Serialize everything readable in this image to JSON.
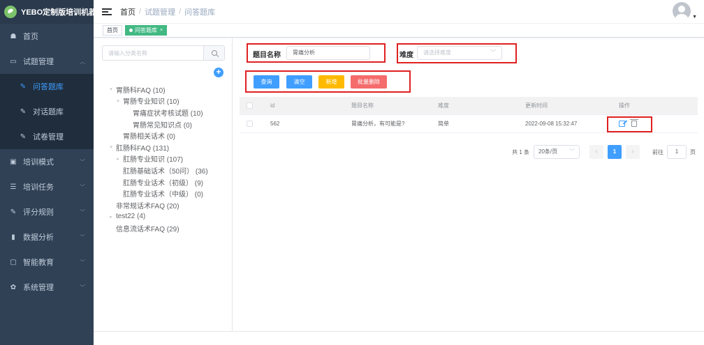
{
  "app": {
    "title": "YEBO定制版培训机器人"
  },
  "sidebar": {
    "items": [
      {
        "label": "首页",
        "icon": "dashboard-icon"
      },
      {
        "label": "试题管理",
        "icon": "book-icon",
        "expanded": true,
        "children": [
          {
            "label": "问答题库",
            "icon": "edit-icon",
            "active": true
          },
          {
            "label": "对话题库",
            "icon": "edit-icon"
          },
          {
            "label": "试卷管理",
            "icon": "edit-icon"
          }
        ]
      },
      {
        "label": "培训模式",
        "icon": "monitor-icon"
      },
      {
        "label": "培训任务",
        "icon": "list-icon"
      },
      {
        "label": "评分规则",
        "icon": "edit-icon"
      },
      {
        "label": "数据分析",
        "icon": "bar-chart-icon"
      },
      {
        "label": "智能教育",
        "icon": "screen-icon"
      },
      {
        "label": "系统管理",
        "icon": "gear-icon"
      }
    ]
  },
  "header": {
    "breadcrumb": [
      "首页",
      "试题管理",
      "问答题库"
    ],
    "separator": "/"
  },
  "tags": [
    {
      "label": "首页",
      "active": false
    },
    {
      "label": "问答题库",
      "active": true,
      "close": "×"
    }
  ],
  "tree": {
    "search_placeholder": "请输入分类名称",
    "nodes": [
      {
        "label": "胃肠科FAQ (10)",
        "level": 0,
        "caret": "down"
      },
      {
        "label": "胃肠专业知识 (10)",
        "level": 1,
        "caret": "down"
      },
      {
        "label": "胃痛症状考核试题 (10)",
        "level": 2,
        "caret": ""
      },
      {
        "label": "胃肠常见知识点 (0)",
        "level": 2,
        "caret": ""
      },
      {
        "label": "胃肠相关话术 (0)",
        "level": 1,
        "caret": ""
      },
      {
        "label": "肛肠科FAQ (131)",
        "level": 0,
        "caret": "down"
      },
      {
        "label": "肛肠专业知识 (107)",
        "level": 1,
        "caret": "right"
      },
      {
        "label": "肛肠基础话术（50问） (36)",
        "level": 1,
        "caret": ""
      },
      {
        "label": "肛肠专业话术（初级） (9)",
        "level": 1,
        "caret": ""
      },
      {
        "label": "肛肠专业话术（中级） (0)",
        "level": 1,
        "caret": ""
      },
      {
        "label": "非常规话术FAQ (20)",
        "level": 0,
        "caret": ""
      },
      {
        "label": "test22 (4)",
        "level": 0,
        "caret": "right"
      },
      {
        "label": "信息流话术FAQ (29)",
        "level": 0,
        "caret": ""
      }
    ]
  },
  "filter": {
    "name_label": "题目名称",
    "name_value": "胃痛分析",
    "difficulty_label": "难度",
    "difficulty_placeholder": "请选择难度"
  },
  "actions": {
    "query": "查询",
    "clear": "清空",
    "add": "新增",
    "batch_delete": "批量删除"
  },
  "table": {
    "columns": [
      "id",
      "题目名称",
      "难度",
      "更新时间",
      "操作"
    ],
    "rows": [
      {
        "id": "562",
        "name": "胃痛分析，有可能是?",
        "difficulty": "简单",
        "updated": "2022-09-08 15:32:47"
      }
    ]
  },
  "pagination": {
    "total": "共 1 条",
    "page_size": "20条/页",
    "current_page": "1",
    "goto_prefix": "前往",
    "goto_value": "1",
    "goto_suffix": "页"
  },
  "colors": {
    "sidebar_bg": "#304156",
    "primary": "#409eff",
    "tag_active": "#42b983",
    "add_button": "#ffba00",
    "delete_button": "#f56c6c",
    "highlight_box": "#e02020"
  }
}
